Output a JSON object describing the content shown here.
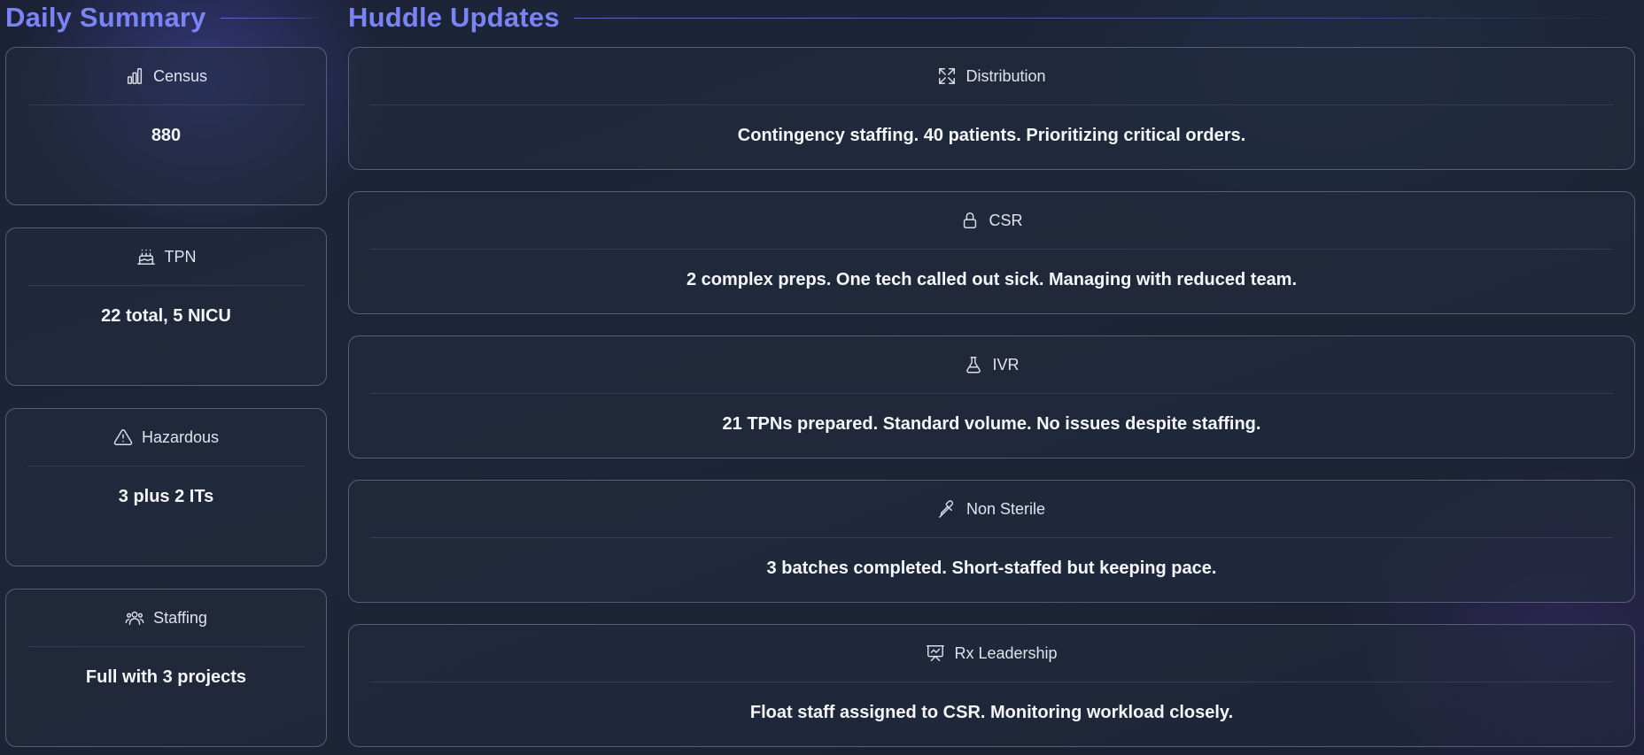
{
  "daily_summary": {
    "title": "Daily Summary",
    "cards": [
      {
        "label": "Census",
        "value": "880",
        "icon": "bar-chart-icon"
      },
      {
        "label": "TPN",
        "value": "22 total, 5 NICU",
        "icon": "cake-icon"
      },
      {
        "label": "Hazardous",
        "value": "3 plus 2 ITs",
        "icon": "warning-triangle-icon"
      },
      {
        "label": "Staffing",
        "value": "Full with 3 projects",
        "icon": "users-icon"
      }
    ]
  },
  "huddle_updates": {
    "title": "Huddle Updates",
    "items": [
      {
        "label": "Distribution",
        "text": "Contingency staffing. 40 patients. Prioritizing critical orders.",
        "icon": "expand-arrows-icon"
      },
      {
        "label": "CSR",
        "text": "2 complex preps. One tech called out sick. Managing with reduced team.",
        "icon": "lock-icon"
      },
      {
        "label": "IVR",
        "text": "21 TPNs prepared. Standard volume. No issues despite staffing.",
        "icon": "flask-icon"
      },
      {
        "label": "Non Sterile",
        "text": "3 batches completed. Short-staffed but keeping pace.",
        "icon": "pipette-icon"
      },
      {
        "label": "Rx Leadership",
        "text": "Float staff assigned to CSR. Monitoring workload closely.",
        "icon": "presentation-chart-icon"
      }
    ]
  },
  "colors": {
    "accent": "#7b84f5",
    "background": "#1d2638",
    "card_border": "#aab9d7"
  }
}
